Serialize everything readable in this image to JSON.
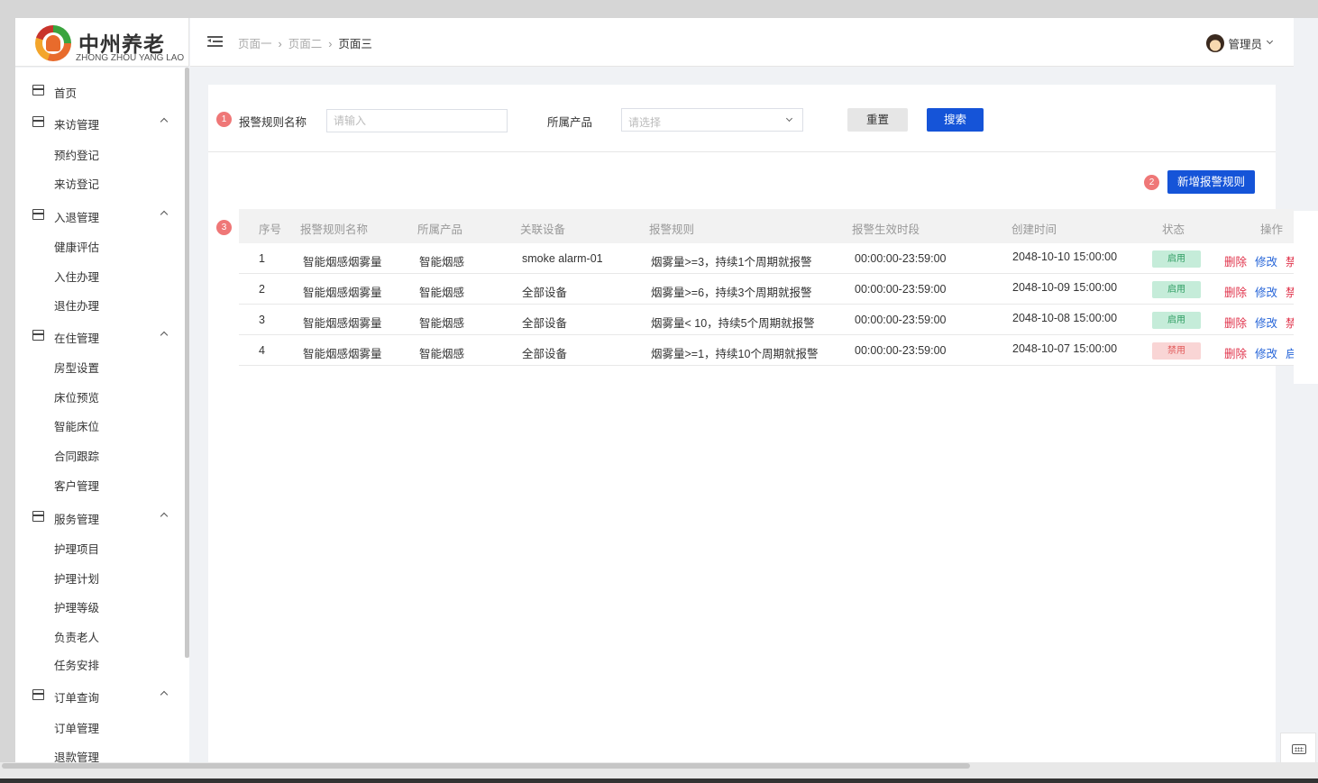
{
  "logo": {
    "cn": "中州养老",
    "en": "ZHONG ZHOU YANG LAO"
  },
  "header": {
    "breadcrumb": [
      "页面一",
      "页面二",
      "页面三"
    ],
    "user": "管理员"
  },
  "sidebar": {
    "home": "首页",
    "groups": [
      {
        "label": "来访管理",
        "items": [
          "预约登记",
          "来访登记"
        ]
      },
      {
        "label": "入退管理",
        "items": [
          "健康评估",
          "入住办理",
          "退住办理"
        ]
      },
      {
        "label": "在住管理",
        "items": [
          "房型设置",
          "床位预览",
          "智能床位",
          "合同跟踪",
          "客户管理"
        ]
      },
      {
        "label": "服务管理",
        "items": [
          "护理项目",
          "护理计划",
          "护理等级",
          "负责老人",
          "任务安排"
        ]
      },
      {
        "label": "订单查询",
        "items": [
          "订单管理",
          "退款管理"
        ]
      }
    ]
  },
  "filters": {
    "badge1": "1",
    "rule_name_label": "报警规则名称",
    "rule_name_placeholder": "请输入",
    "product_label": "所属产品",
    "product_placeholder": "请选择",
    "reset": "重置",
    "search": "搜索"
  },
  "actions": {
    "badge2": "2",
    "add": "新增报警规则"
  },
  "table": {
    "badge3": "3",
    "headers": [
      "序号",
      "报警规则名称",
      "所属产品",
      "关联设备",
      "报警规则",
      "报警生效时段",
      "创建时间",
      "状态",
      "操作"
    ],
    "rows": [
      {
        "no": "1",
        "name": "智能烟感烟雾量",
        "product": "智能烟感",
        "device": "smoke alarm-01",
        "rule": "烟雾量>=3，持续1个周期就报警",
        "period": "00:00:00-23:59:00",
        "created": "2048-10-10 15:00:00",
        "status": "启用",
        "enabled": true,
        "del": "删除",
        "edit": "修改",
        "toggle": "禁用"
      },
      {
        "no": "2",
        "name": "智能烟感烟雾量",
        "product": "智能烟感",
        "device": "全部设备",
        "rule": "烟雾量>=6，持续3个周期就报警",
        "period": "00:00:00-23:59:00",
        "created": "2048-10-09 15:00:00",
        "status": "启用",
        "enabled": true,
        "del": "删除",
        "edit": "修改",
        "toggle": "禁用"
      },
      {
        "no": "3",
        "name": "智能烟感烟雾量",
        "product": "智能烟感",
        "device": "全部设备",
        "rule": "烟雾量< 10，持续5个周期就报警",
        "period": "00:00:00-23:59:00",
        "created": "2048-10-08 15:00:00",
        "status": "启用",
        "enabled": true,
        "del": "删除",
        "edit": "修改",
        "toggle": "禁用"
      },
      {
        "no": "4",
        "name": "智能烟感烟雾量",
        "product": "智能烟感",
        "device": "全部设备",
        "rule": "烟雾量>=1，持续10个周期就报警",
        "period": "00:00:00-23:59:00",
        "created": "2048-10-07 15:00:00",
        "status": "禁用",
        "enabled": false,
        "del": "删除",
        "edit": "修改",
        "toggle": "启用"
      }
    ]
  },
  "colors": {
    "primary": "#1554d8",
    "danger": "#e0324a",
    "badge": "#ef7777"
  }
}
